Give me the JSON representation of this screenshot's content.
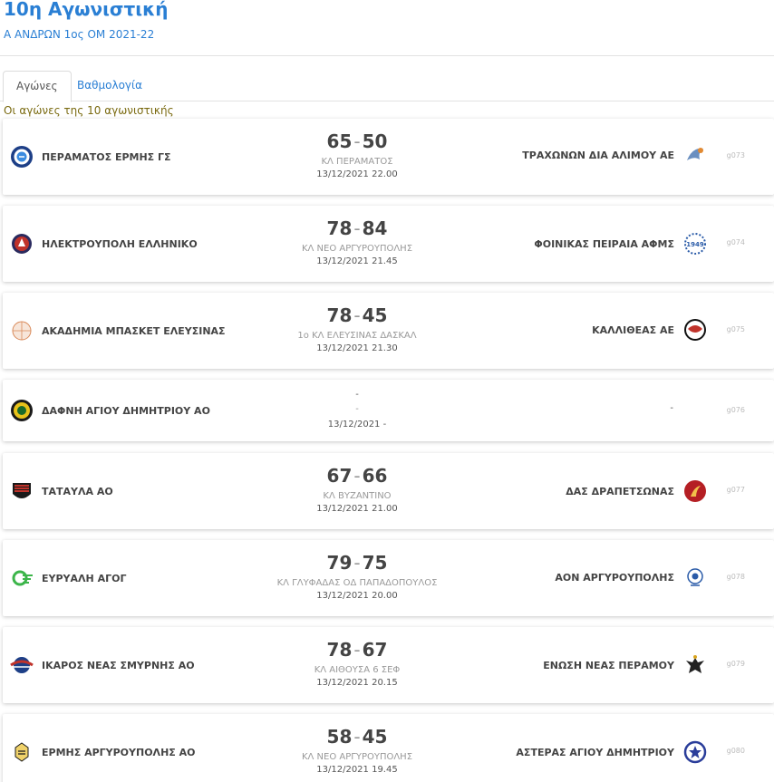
{
  "header": {
    "title": "10η Αγωνιστική",
    "subtitle": "Α ΑΝΔΡΩΝ 1ος ΟΜ 2021-22"
  },
  "tabs": [
    {
      "label": "Αγώνες",
      "active": true
    },
    {
      "label": "Βαθμολογία",
      "active": false
    }
  ],
  "section_note": "Οι αγώνες της 10 αγωνιστικής",
  "matches": [
    {
      "home": "ΠΕΡΑΜΑΤΟΣ ΕΡΜΗΣ ΓΣ",
      "home_score": "65",
      "away_score": "50",
      "away": "ΤΡΑΧΩΝΩΝ ΔΙΑ ΑΛΙΜΟΥ ΑΕ",
      "venue": "ΚΛ ΠΕΡΑΜΑΤΟΣ",
      "datetime": "13/12/2021 22.00",
      "code": "g073",
      "home_icon": "hermes-crest-icon",
      "away_icon": "trachones-crest-icon"
    },
    {
      "home": "ΗΛΕΚΤΡΟΥΠΟΛΗ ΕΛΛΗΝΙΚΟ",
      "home_score": "78",
      "away_score": "84",
      "away": "ΦΟΙΝΙΚΑΣ ΠΕΙΡΑΙΑ ΑΦΜΣ",
      "venue": "ΚΛ ΝΕΟ ΑΡΓΥΡΟΥΠΟΛΗΣ",
      "datetime": "13/12/2021 21.45",
      "code": "g074",
      "home_icon": "ilektroupoli-crest-icon",
      "away_icon": "foinikas-crest-icon",
      "away_badge_text": "1949"
    },
    {
      "home": "ΑΚΑΔΗΜΙΑ ΜΠΑΣΚΕΤ ΕΛΕΥΣΙΝΑΣ",
      "home_score": "78",
      "away_score": "45",
      "away": "ΚΑΛΛΙΘΕΑΣ ΑΕ",
      "venue": "1ο ΚΛ ΕΛΕΥΣΙΝΑΣ ΔΑΣΚΑΛ",
      "datetime": "13/12/2021 21.30",
      "code": "g075",
      "home_icon": "basketball-academy-icon",
      "away_icon": "kallithea-crest-icon"
    },
    {
      "home": "ΔΑΦΝΗ ΑΓΙΟΥ ΔΗΜΗΤΡΙΟΥ ΑΟ",
      "home_score": "",
      "away_score": "",
      "score_placeholder": "-",
      "venue_placeholder": "-",
      "away": "-",
      "venue": "",
      "datetime": "13/12/2021 -",
      "code": "g076",
      "home_icon": "dafni-crest-icon",
      "away_icon": ""
    },
    {
      "home": "ΤΑΤΑΥΛΑ ΑΟ",
      "home_score": "67",
      "away_score": "66",
      "away": "ΔΑΣ ΔΡΑΠΕΤΣΩΝΑΣ",
      "venue": "ΚΛ ΒΥΖΑΝΤΙΝΟ",
      "datetime": "13/12/2021 21.00",
      "code": "g077",
      "home_icon": "tatavla-crest-icon",
      "away_icon": "drapetsona-crest-icon"
    },
    {
      "home": "ΕΥΡΥΑΛΗ ΑΓΟΓ",
      "home_score": "79",
      "away_score": "75",
      "away": "ΑΟΝ ΑΡΓΥΡΟΥΠΟΛΗΣ",
      "venue": "ΚΛ ΓΛΥΦΑΔΑΣ ΟΔ ΠΑΠΑΔΟΠΟΥΛΟΣ",
      "datetime": "13/12/2021 20.00",
      "code": "g078",
      "home_icon": "evryali-crest-icon",
      "away_icon": "aon-crest-icon"
    },
    {
      "home": "ΙΚΑΡΟΣ ΝΕΑΣ ΣΜΥΡΝΗΣ ΑΟ",
      "home_score": "78",
      "away_score": "67",
      "away": "ΕΝΩΣΗ ΝΕΑΣ ΠΕΡΑΜΟΥ",
      "venue": "ΚΛ ΑΙΘΟΥΣΑ 6 ΣΕΦ",
      "datetime": "13/12/2021 20.15",
      "code": "g079",
      "home_icon": "ikaros-crest-icon",
      "away_icon": "eagle-crest-icon"
    },
    {
      "home": "ΕΡΜΗΣ ΑΡΓΥΡΟΥΠΟΛΗΣ ΑΟ",
      "home_score": "58",
      "away_score": "45",
      "away": "ΑΣΤΕΡΑΣ ΑΓΙΟΥ ΔΗΜΗΤΡΙΟΥ",
      "venue": "ΚΛ ΝΕΟ ΑΡΓΥΡΟΥΠΟΛΗΣ",
      "datetime": "13/12/2021 19.45",
      "code": "g080",
      "home_icon": "ermis-crest-icon",
      "away_icon": "star-crest-icon"
    }
  ]
}
